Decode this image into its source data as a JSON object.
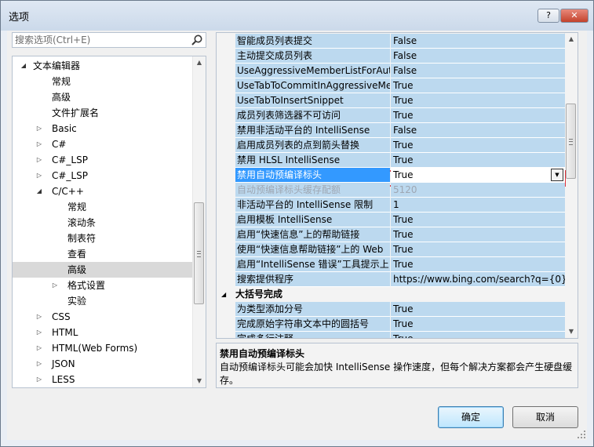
{
  "window": {
    "title": "选项",
    "help_label": "?",
    "close_label": "✕"
  },
  "search": {
    "placeholder": "搜索选项(Ctrl+E)"
  },
  "tree": {
    "items": [
      {
        "label": "文本编辑器",
        "level": 0,
        "arrow": "◢"
      },
      {
        "label": "常规",
        "level": 1,
        "arrow": ""
      },
      {
        "label": "高级",
        "level": 1,
        "arrow": ""
      },
      {
        "label": "文件扩展名",
        "level": 1,
        "arrow": ""
      },
      {
        "label": "Basic",
        "level": 1,
        "arrow": "▷"
      },
      {
        "label": "C#",
        "level": 1,
        "arrow": "▷"
      },
      {
        "label": "C#_LSP",
        "level": 1,
        "arrow": "▷"
      },
      {
        "label": "C#_LSP",
        "level": 1,
        "arrow": "▷"
      },
      {
        "label": "C/C++",
        "level": 1,
        "arrow": "◢"
      },
      {
        "label": "常规",
        "level": 2,
        "arrow": ""
      },
      {
        "label": "滚动条",
        "level": 2,
        "arrow": ""
      },
      {
        "label": "制表符",
        "level": 2,
        "arrow": ""
      },
      {
        "label": "查看",
        "level": 2,
        "arrow": ""
      },
      {
        "label": "高级",
        "level": 2,
        "arrow": "",
        "selected": true
      },
      {
        "label": "格式设置",
        "level": 2,
        "arrow": "▷"
      },
      {
        "label": "实验",
        "level": 2,
        "arrow": ""
      },
      {
        "label": "CSS",
        "level": 1,
        "arrow": "▷"
      },
      {
        "label": "HTML",
        "level": 1,
        "arrow": "▷"
      },
      {
        "label": "HTML(Web Forms)",
        "level": 1,
        "arrow": "▷"
      },
      {
        "label": "JSON",
        "level": 1,
        "arrow": "▷"
      },
      {
        "label": "LESS",
        "level": 1,
        "arrow": "▷"
      }
    ]
  },
  "properties": {
    "rows": [
      {
        "name": "智能成员列表提交",
        "value": "False"
      },
      {
        "name": "主动提交成员列表",
        "value": "False"
      },
      {
        "name": "UseAggressiveMemberListForAuto",
        "value": "False"
      },
      {
        "name": "UseTabToCommitInAggressiveMem",
        "value": "True"
      },
      {
        "name": "UseTabToInsertSnippet",
        "value": "True"
      },
      {
        "name": "成员列表筛选器不可访问",
        "value": "True"
      },
      {
        "name": "禁用非活动平台的 IntelliSense",
        "value": "False"
      },
      {
        "name": "启用成员列表的点到箭头替换",
        "value": "True"
      },
      {
        "name": "禁用 HLSL IntelliSense",
        "value": "True"
      },
      {
        "name": "禁用自动预编译标头",
        "value": "True",
        "selected": true
      },
      {
        "name": "自动预编译标头缓存配额",
        "value": "5120",
        "dim": true
      },
      {
        "name": "非活动平台的 IntelliSense 限制",
        "value": "1"
      },
      {
        "name": "启用模板 IntelliSense",
        "value": "True"
      },
      {
        "name": "启用“快速信息”上的帮助链接",
        "value": "True"
      },
      {
        "name": "使用“快速信息帮助链接”上的 Web",
        "value": "True"
      },
      {
        "name": "启用“IntelliSense 错误”工具提示上",
        "value": "True"
      },
      {
        "name": "搜索提供程序",
        "value": "https://www.bing.com/search?q={0}"
      }
    ],
    "category": {
      "label": "大括号完成",
      "arrow": "◢"
    },
    "rows2": [
      {
        "name": "为类型添加分号",
        "value": "True"
      },
      {
        "name": "完成原始字符串文本中的圆括号",
        "value": "True"
      },
      {
        "name": "完成多行注释",
        "value": "True"
      }
    ]
  },
  "description": {
    "title": "禁用自动预编译标头",
    "text": "自动预编译标头可能会加快 IntelliSense 操作速度，但每个解决方案都会产生硬盘缓存。"
  },
  "buttons": {
    "ok": "确定",
    "cancel": "取消"
  },
  "colors": {
    "selected_name_bg": "#3399ff",
    "highlight_box": "#e0323a",
    "row_bg": "#bcd9ef"
  }
}
